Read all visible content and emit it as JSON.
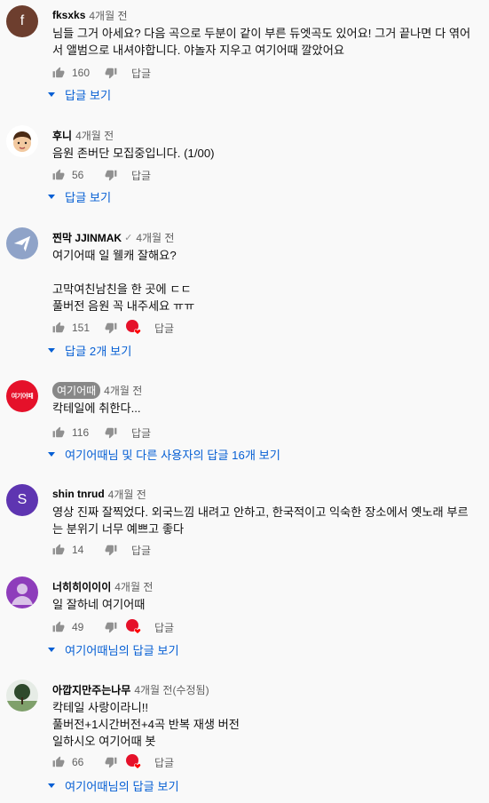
{
  "colors": {
    "link": "#065fd4",
    "meta": "#606060",
    "heart": "#ff0000"
  },
  "reply_label": "답글",
  "comments": [
    {
      "author": "fksxks",
      "time": "4개월 전",
      "avatar_letter": "f",
      "avatar_color": "#6d3e2e",
      "lines": [
        "님들 그거 아세요? 다음 곡으로 두분이 같이 부른 듀엣곡도 있어요! 그거 끝나면 다 엮어",
        "서 앨범으로 내셔야합니다. 야놀자 지우고 여기어때 깔았어요"
      ],
      "likes": "160",
      "replies": "답글 보기"
    },
    {
      "author": "후니",
      "time": "4개월 전",
      "avatar_icon": "boy-face-icon",
      "lines": [
        "음원 존버단 모집중입니다. (1/00)"
      ],
      "likes": "56",
      "replies": "답글 보기"
    },
    {
      "author": "찐막 JJINMAK",
      "time": "4개월 전",
      "avatar_icon": "paper-plane-icon",
      "avatar_color": "#8fa3c8",
      "lines": [
        "여기어때 일 웰캐 잘해요?",
        "",
        "고막여친남친을 한 곳에 ㄷㄷ",
        "풀버전 음원 꼭 내주세요 ㅠㅠ"
      ],
      "likes": "151",
      "replies": "답글 2개 보기"
    },
    {
      "author": "여기어때",
      "time": "4개월 전",
      "avatar_text": "여기어때",
      "avatar_color": "#e5112a",
      "lines": [
        "칵테일에 취한다..."
      ],
      "likes": "116",
      "replies": "여기어때님 및 다른 사용자의 답글 16개 보기"
    },
    {
      "author": "shin tnrud",
      "time": "4개월 전",
      "avatar_letter": "S",
      "avatar_color": "#5e35b1",
      "lines": [
        "영상 진짜 잘찍었다. 외국느낌 내려고 안하고, 한국적이고 익숙한 장소에서 옛노래 부르",
        "는 분위기 너무 예쁘고 좋다"
      ],
      "likes": "14"
    },
    {
      "author": "너히히이이이",
      "time": "4개월 전",
      "avatar_icon": "default-user-icon",
      "avatar_color": "#8e3dbb",
      "lines": [
        "일 잘하네 여기어때"
      ],
      "likes": "49",
      "replies": "여기어때님의 답글 보기"
    },
    {
      "author": "아깝지만주는나무",
      "time": "4개월 전(수정됨)",
      "avatar_icon": "tree-icon",
      "lines": [
        "칵테일 사랑이라니!!",
        "풀버전+1시간버전+4곡 반복 재생 버전",
        "일하시오 여기어때 봇"
      ],
      "likes": "66",
      "replies": "여기어때님의 답글 보기"
    }
  ]
}
